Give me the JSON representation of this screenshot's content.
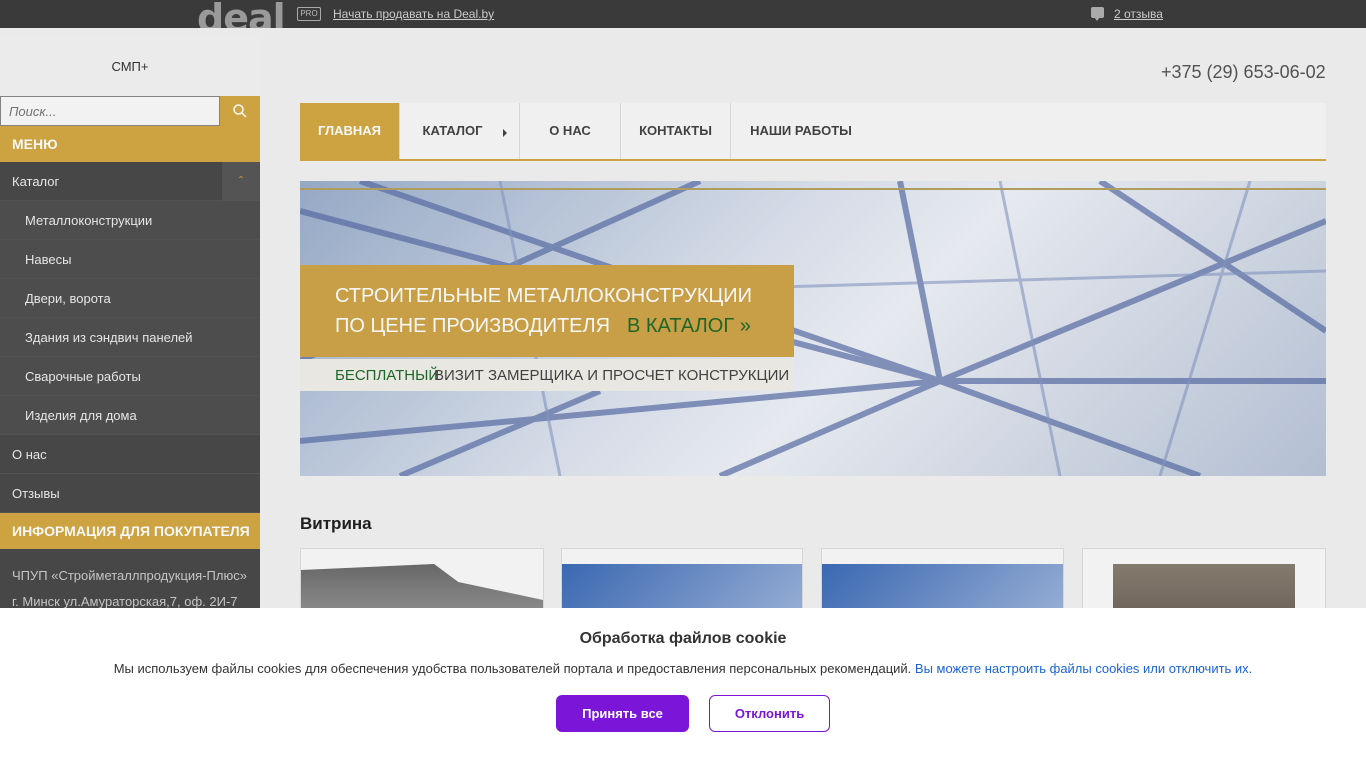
{
  "topbar": {
    "logo": "deal",
    "pro_badge": "PRO",
    "sell_link": "Начать продавать на Deal.by",
    "reviews_link": "2 отзыва"
  },
  "sidebar": {
    "brand": "СМП+",
    "search_placeholder": "Поиск...",
    "menu_header": "Меню",
    "catalog": "Каталог",
    "sub_items": [
      "Металлоконструкции",
      "Навесы",
      "Двери, ворота",
      "Здания из сэндвич панелей",
      "Сварочные работы",
      "Изделия для дома"
    ],
    "about": "О нас",
    "reviews": "Отзывы",
    "info_header": "Информация для покупателя",
    "company": "ЧПУП «Стройметаллпродукция-Плюс»",
    "address": "г. Минск ул.Амураторская,7, оф. 2И-7"
  },
  "header": {
    "phone": "+375 (29) 653-06-02"
  },
  "nav": {
    "items": [
      "Главная",
      "Каталог",
      "О нас",
      "Контакты",
      "Наши работы"
    ]
  },
  "banner": {
    "line1": "СТРОИТЕЛЬНЫЕ МЕТАЛЛОКОНСТРУКЦИИ",
    "line2": "ПО ЦЕНЕ ПРОИЗВОДИТЕЛЯ",
    "cta": "В КАТАЛОГ",
    "free": "БЕСПЛАТНЫЙ",
    "rest": "ВИЗИТ ЗАМЕРЩИКА И ПРОСЧЕТ КОНСТРУКЦИИ"
  },
  "showcase": {
    "title": "Витрина"
  },
  "cookie": {
    "title": "Обработка файлов cookie",
    "text": "Мы используем файлы cookies для обеспечения удобства пользователей портала и предоставления персональных рекомендаций.",
    "link": "Вы можете настроить файлы cookies или отключить их.",
    "accept": "Принять все",
    "decline": "Отклонить"
  },
  "colors": {
    "accent": "#d4a944",
    "sidebar_bg": "#4a4a4a",
    "cookie_button": "#7b16d8",
    "link": "#1a64d6"
  }
}
